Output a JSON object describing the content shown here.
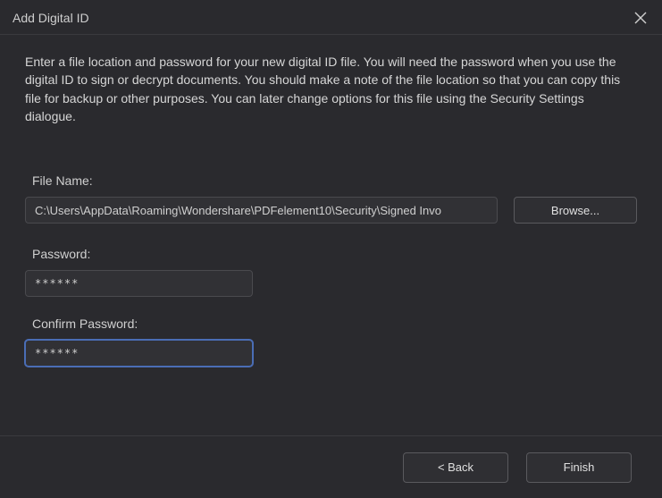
{
  "titlebar": {
    "title": "Add Digital ID"
  },
  "intro_text": "Enter a file location and password for your new digital ID file. You will need the password when you use the digital ID to sign or decrypt documents. You should make a note of the file location so that you can copy this file for backup or other purposes. You can later change options for this file using the Security Settings dialogue.",
  "file": {
    "label": "File Name:",
    "value": "C:\\Users\\AppData\\Roaming\\Wondershare\\PDFelement10\\Security\\Signed Invo",
    "browse_label": "Browse..."
  },
  "password": {
    "label": "Password:",
    "value": "******"
  },
  "confirm": {
    "label": "Confirm Password:",
    "value": "******"
  },
  "footer": {
    "back_label": "< Back",
    "finish_label": "Finish"
  }
}
